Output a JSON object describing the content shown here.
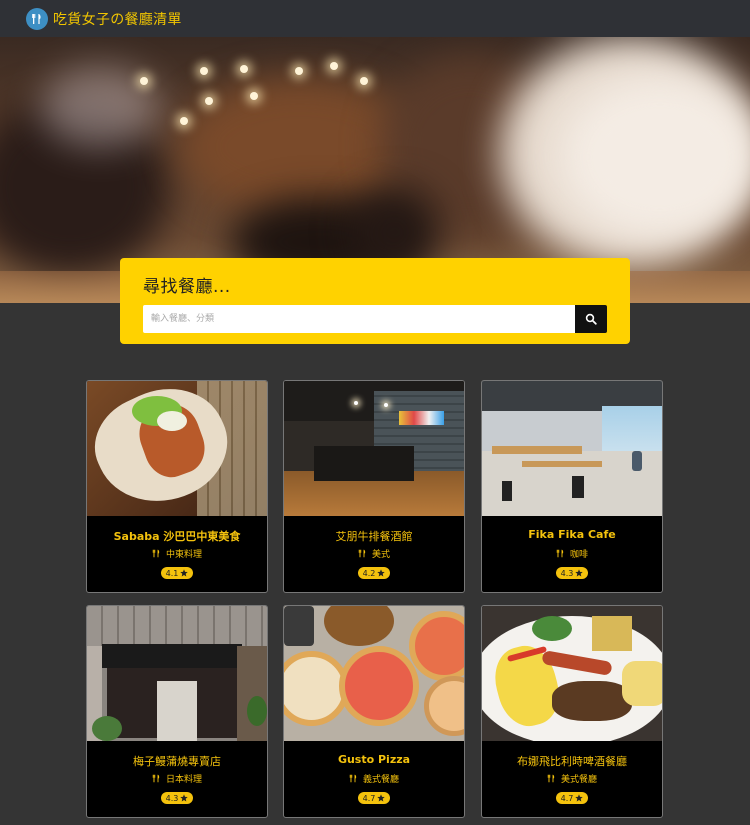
{
  "app": {
    "title": "吃貨女子の餐廳清單"
  },
  "search": {
    "title": "尋找餐廳...",
    "placeholder": "輸入餐廳、分類"
  },
  "restaurants": [
    {
      "name": "Sababa 沙巴巴中東美食",
      "category": "中東料理",
      "rating": "4.1"
    },
    {
      "name": "艾朋牛排餐酒館",
      "category": "美式",
      "rating": "4.2"
    },
    {
      "name": "Fika Fika Cafe",
      "category": "咖啡",
      "rating": "4.3"
    },
    {
      "name": "梅子鰻蒲燒專賣店",
      "category": "日本料理",
      "rating": "4.3"
    },
    {
      "name": "Gusto Pizza",
      "category": "義式餐廳",
      "rating": "4.7"
    },
    {
      "name": "布娜飛比利時啤酒餐廳",
      "category": "美式餐廳",
      "rating": "4.7"
    }
  ],
  "colors": {
    "accent": "#f4c20d",
    "search_panel": "#ffd200",
    "background": "#343434",
    "navbar": "#2f3136"
  },
  "icons": {
    "brand": "utensils-icon",
    "search": "search-icon",
    "category": "utensils-icon",
    "rating": "star-icon"
  }
}
